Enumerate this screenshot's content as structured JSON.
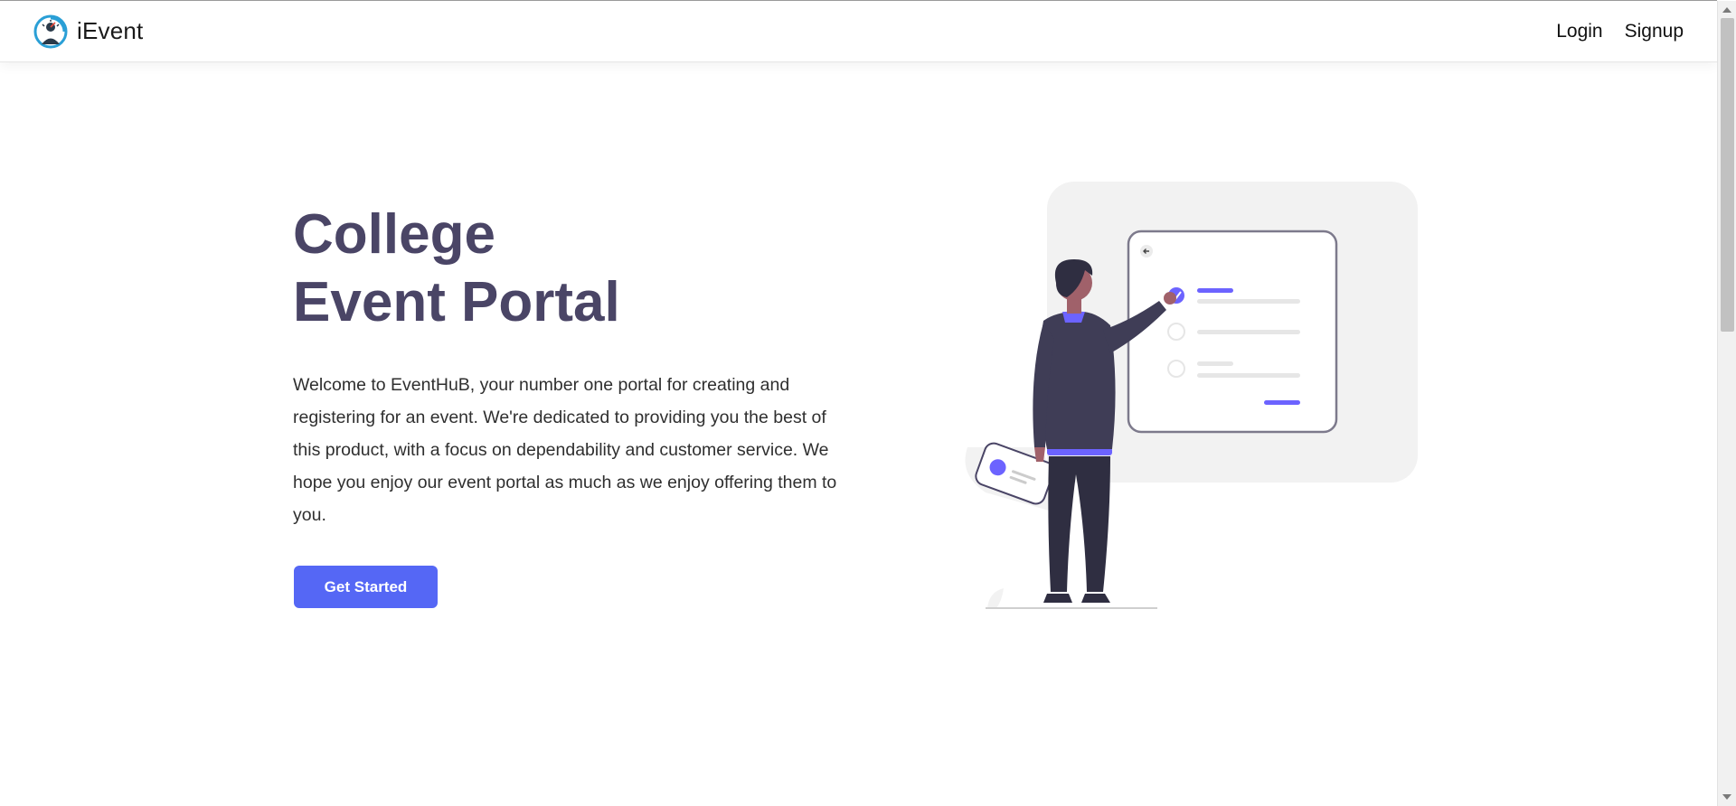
{
  "navbar": {
    "brand_name": "iEvent",
    "logo_icon": "speedometer-person-icon",
    "links": [
      {
        "label": "Login"
      },
      {
        "label": "Signup"
      }
    ]
  },
  "hero": {
    "title_line1": "College",
    "title_line2": "Event Portal",
    "description": "Welcome to EventHuB, your number one portal for creating and registering for an event. We're dedicated to providing you the best of this product, with a focus on dependability and customer service. We hope you enjoy our event portal as much as we enjoy offering them to you.",
    "cta_label": "Get Started"
  },
  "illustration": {
    "icon": "checklist-person-illustration"
  },
  "colors": {
    "title": "#4a4566",
    "accent": "#5567f5",
    "illustration_purple": "#6c63ff",
    "illustration_dark": "#2f2e41"
  }
}
